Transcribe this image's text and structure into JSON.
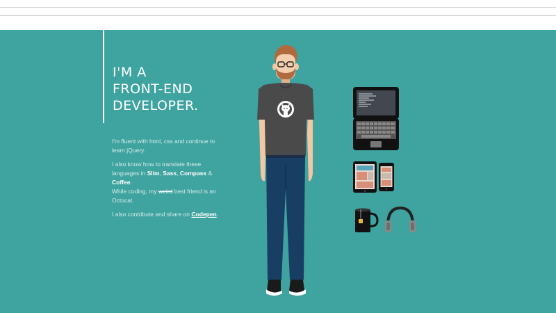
{
  "hero": {
    "headline": [
      "I'M A",
      "FRONT-END",
      "DEVELOPER."
    ],
    "p1": "I'm fluent with html, css and continue to learn jQuery.",
    "p2_a": "I also know how to translate these languages in ",
    "p2_slim": "Slim",
    "p2_sep1": ", ",
    "p2_sass": "Sass",
    "p2_sep2": ", ",
    "p2_compass": "Compass",
    "p2_and": " & ",
    "p2_coffee": "Coffee",
    "p2_end": ".",
    "p3_a": "While coding, my ",
    "p3_weird": "weird",
    "p3_b": " best friend is an Octocat.",
    "p4_a": "I also contribute and share on ",
    "p4_link": "Codepen",
    "p4_end": "."
  },
  "colors": {
    "background": "#3fa3a0",
    "shirt": "#4a4a4a",
    "jeans": "#183e63",
    "hair": "#b06a3e"
  },
  "icons": [
    "octocat-icon",
    "laptop-icon",
    "tablet-icon",
    "phone-icon",
    "mug-icon",
    "headphones-icon"
  ]
}
